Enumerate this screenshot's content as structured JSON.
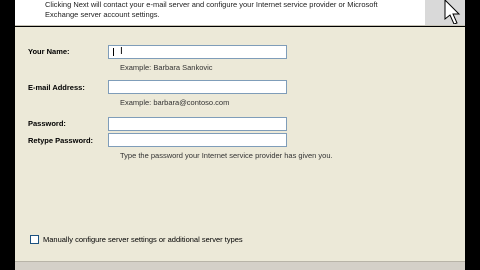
{
  "header": {
    "line1": "Clicking Next will contact your e-mail server and configure your Internet service provider or Microsoft",
    "line2": "Exchange server account settings."
  },
  "form": {
    "name_label": "Your Name:",
    "name_value": "",
    "name_example": "Example: Barbara Sankovic",
    "email_label": "E-mail Address:",
    "email_value": "",
    "email_example": "Example: barbara@contoso.com",
    "password_label": "Password:",
    "password_value": "",
    "retype_label": "Retype Password:",
    "retype_value": "",
    "password_hint": "Type the password your Internet service provider has given you."
  },
  "manual_config": {
    "label": "Manually configure server settings or additional server types",
    "checked": false
  }
}
